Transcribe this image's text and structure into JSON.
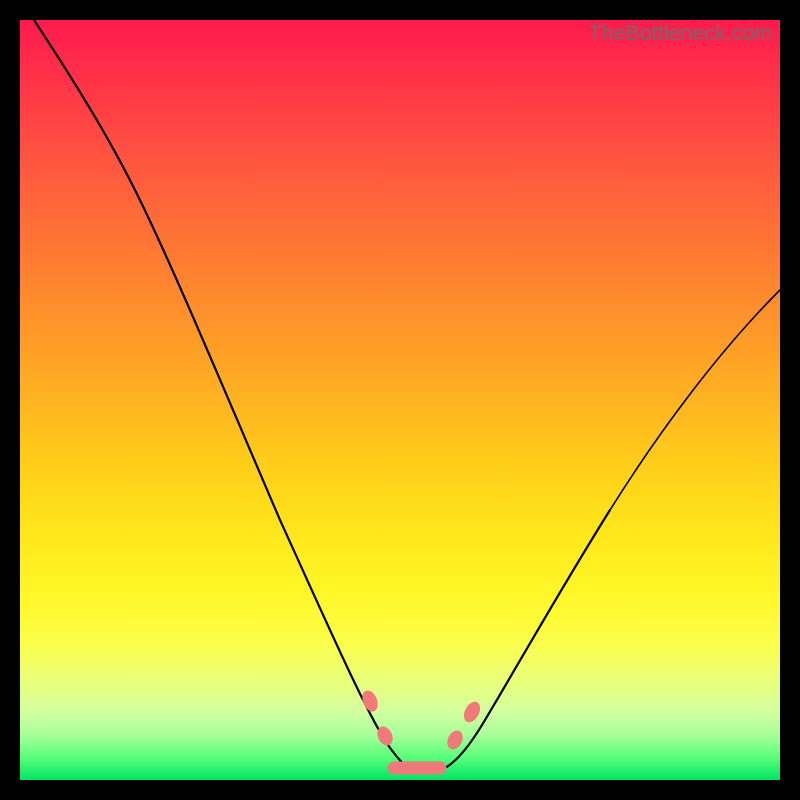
{
  "watermark": "TheBottleneck.com",
  "chart_data": {
    "type": "line",
    "title": "",
    "xlabel": "",
    "ylabel": "",
    "xlim": [
      0,
      100
    ],
    "ylim": [
      0,
      100
    ],
    "grid": false,
    "legend": false,
    "series": [
      {
        "name": "left-curve",
        "x": [
          2,
          6,
          10,
          14,
          18,
          22,
          26,
          30,
          34,
          38,
          42,
          46,
          49,
          51
        ],
        "y": [
          100,
          93,
          84,
          76,
          68,
          59,
          50,
          41,
          32,
          24,
          16,
          8,
          3,
          1
        ]
      },
      {
        "name": "right-curve",
        "x": [
          55,
          57,
          60,
          64,
          68,
          73,
          78,
          84,
          90,
          96,
          100
        ],
        "y": [
          1,
          2,
          4,
          8,
          13,
          20,
          28,
          37,
          47,
          57,
          64
        ]
      }
    ],
    "markers": [
      {
        "name": "left-dot-upper",
        "x": 46,
        "y": 11
      },
      {
        "name": "left-dot-lower",
        "x": 48,
        "y": 6
      },
      {
        "name": "right-dot-lower",
        "x": 57,
        "y": 5
      },
      {
        "name": "right-dot-upper",
        "x": 59,
        "y": 9
      },
      {
        "name": "trough-segment",
        "x0": 49,
        "y0": 2,
        "x1": 55,
        "y1": 2
      }
    ],
    "gradient_stops": [
      {
        "pos": 0,
        "color": "#ff1a4d"
      },
      {
        "pos": 33,
        "color": "#ff8030"
      },
      {
        "pos": 68,
        "color": "#ffe81b"
      },
      {
        "pos": 100,
        "color": "#00e562"
      }
    ]
  }
}
